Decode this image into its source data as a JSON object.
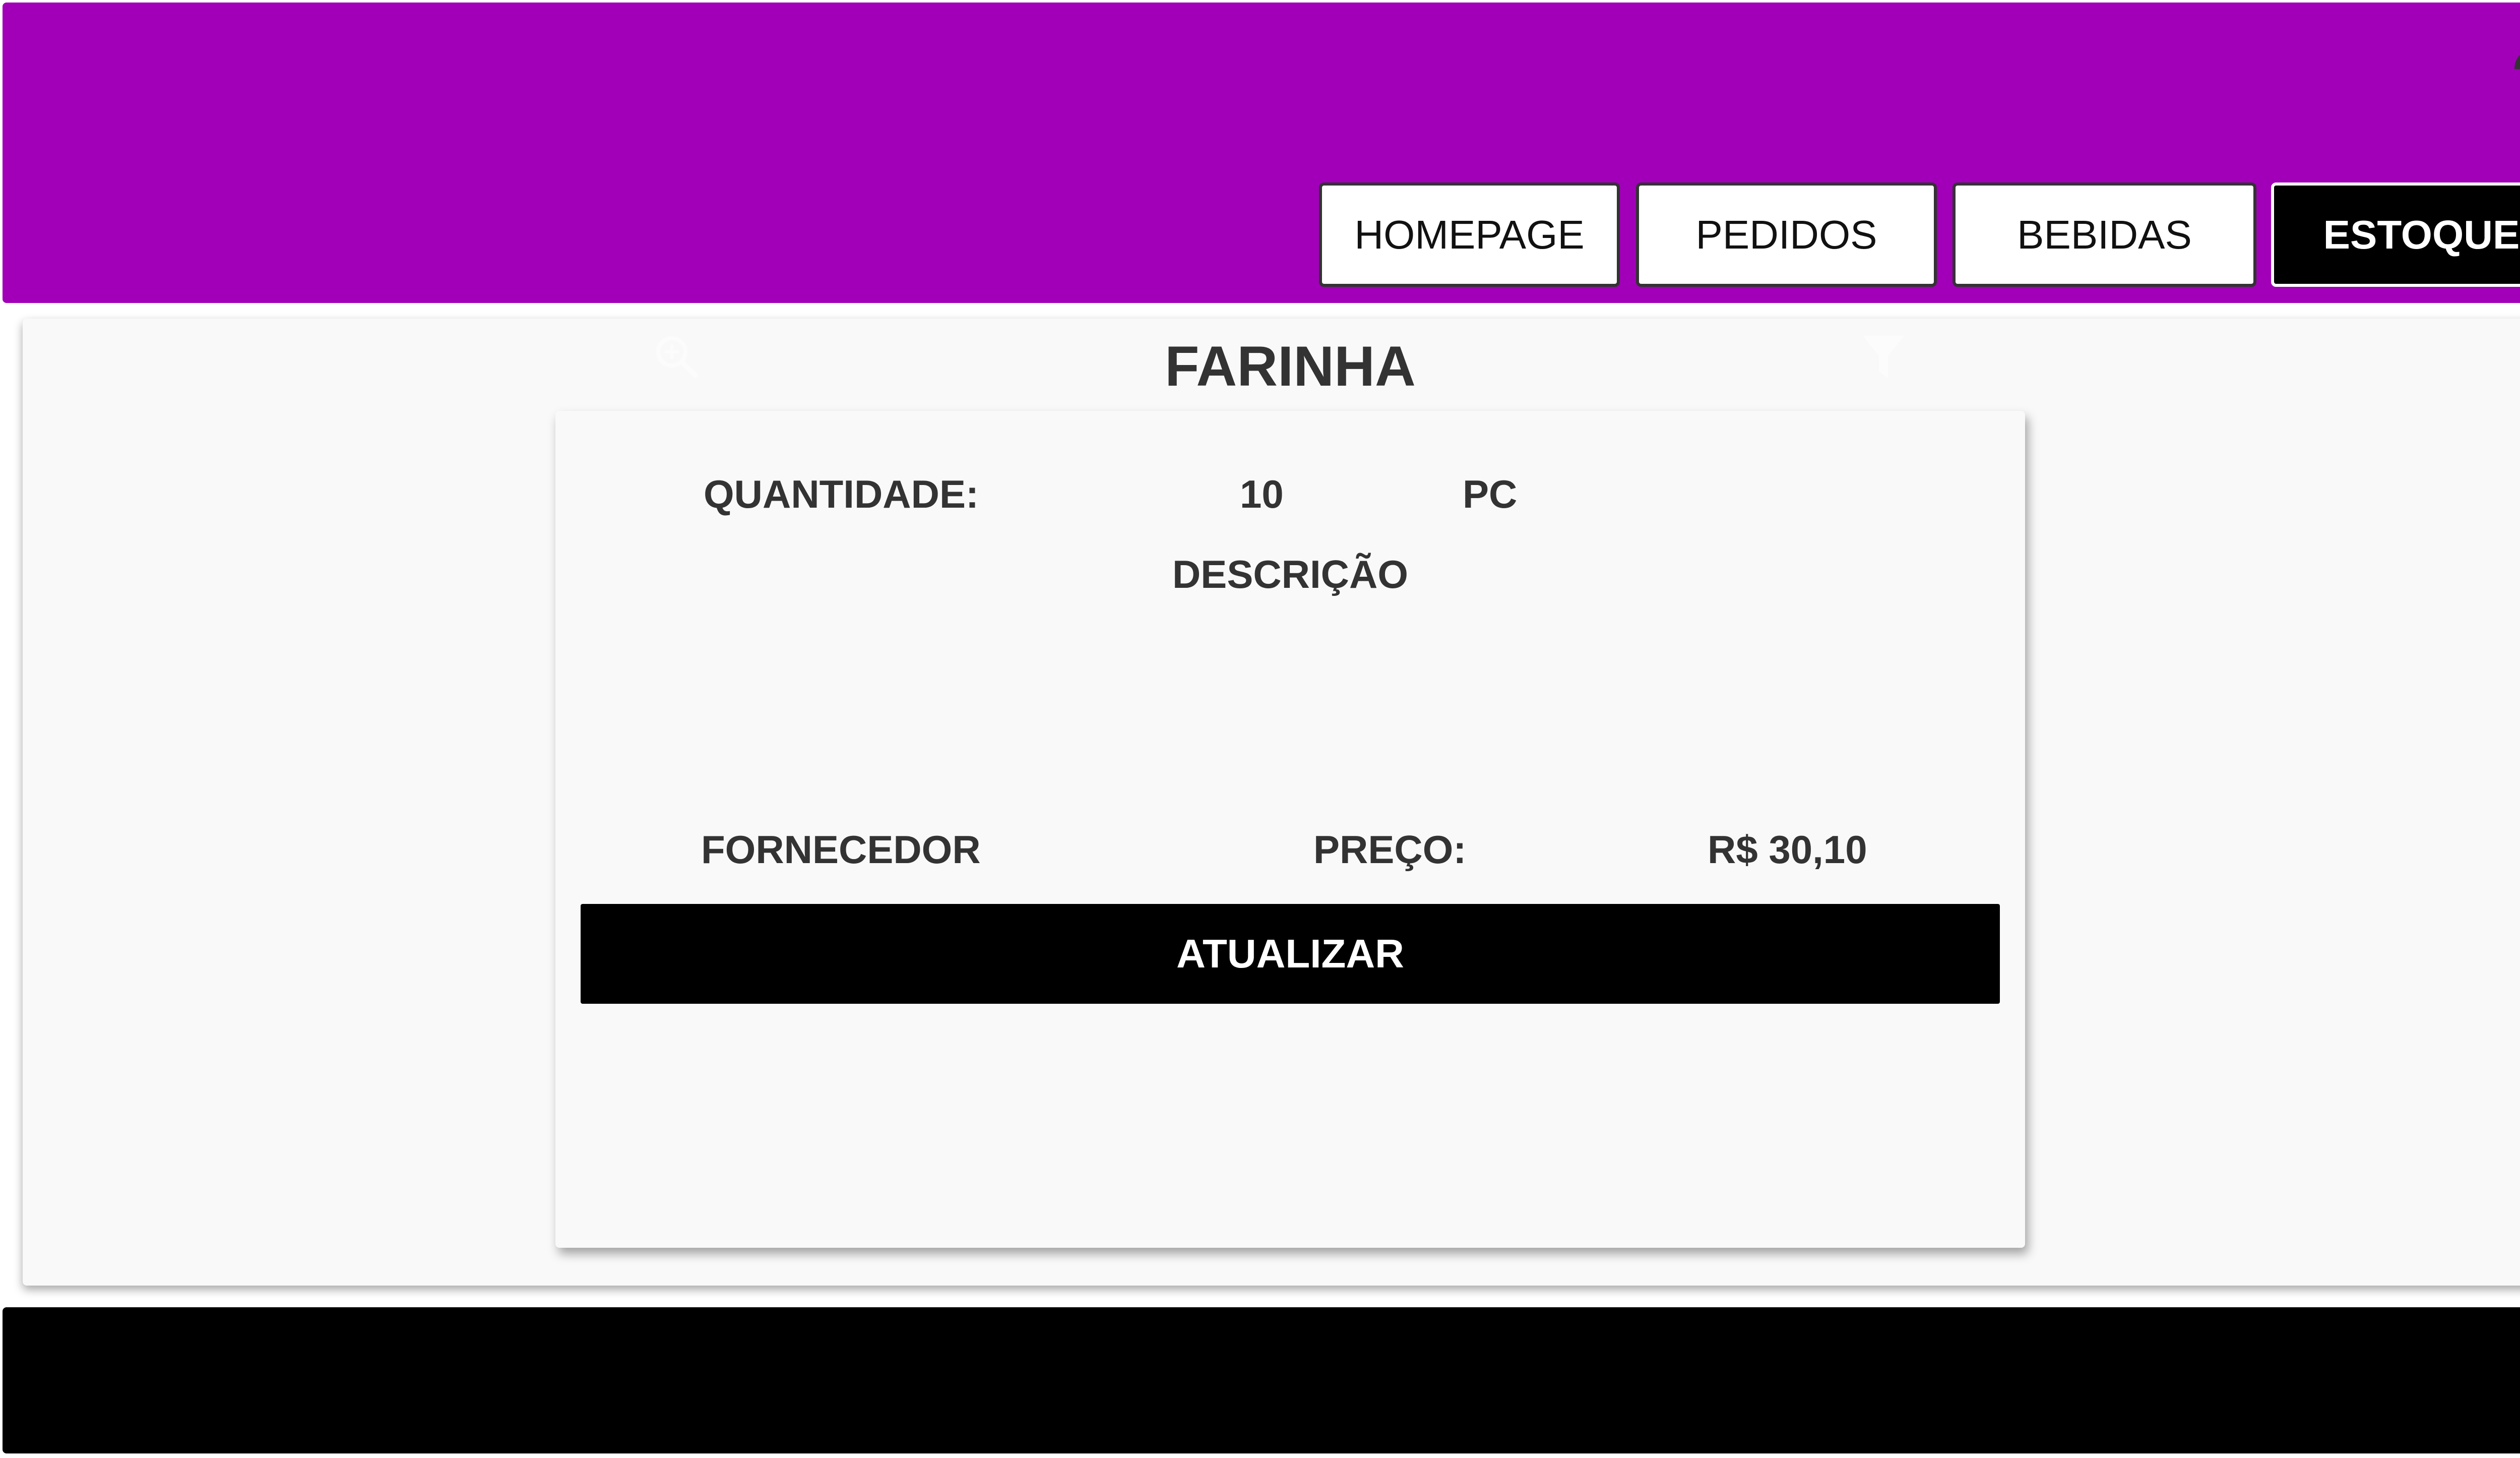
{
  "header": {
    "background_color": "#a100b8",
    "user_icon": "user-menu-icon"
  },
  "nav": {
    "items": [
      {
        "label": "HOMEPAGE",
        "active": false
      },
      {
        "label": "PEDIDOS",
        "active": false
      },
      {
        "label": "BEBIDAS",
        "active": false
      },
      {
        "label": "ESTOQUE",
        "active": true
      }
    ]
  },
  "main": {
    "search_icon": "search-icon",
    "filter_icon": "filter-icon",
    "title": "FARINHA"
  },
  "card": {
    "quantity_label": "QUANTIDADE:",
    "quantity_value": "10",
    "quantity_unit": "PC",
    "description_label": "DESCRIÇÃO",
    "supplier_label": "FORNECEDOR",
    "price_label": "PREÇO:",
    "price_value": "R$ 30,10",
    "update_button": "ATUALIZAR"
  },
  "footer": {
    "background_color": "#000000"
  }
}
